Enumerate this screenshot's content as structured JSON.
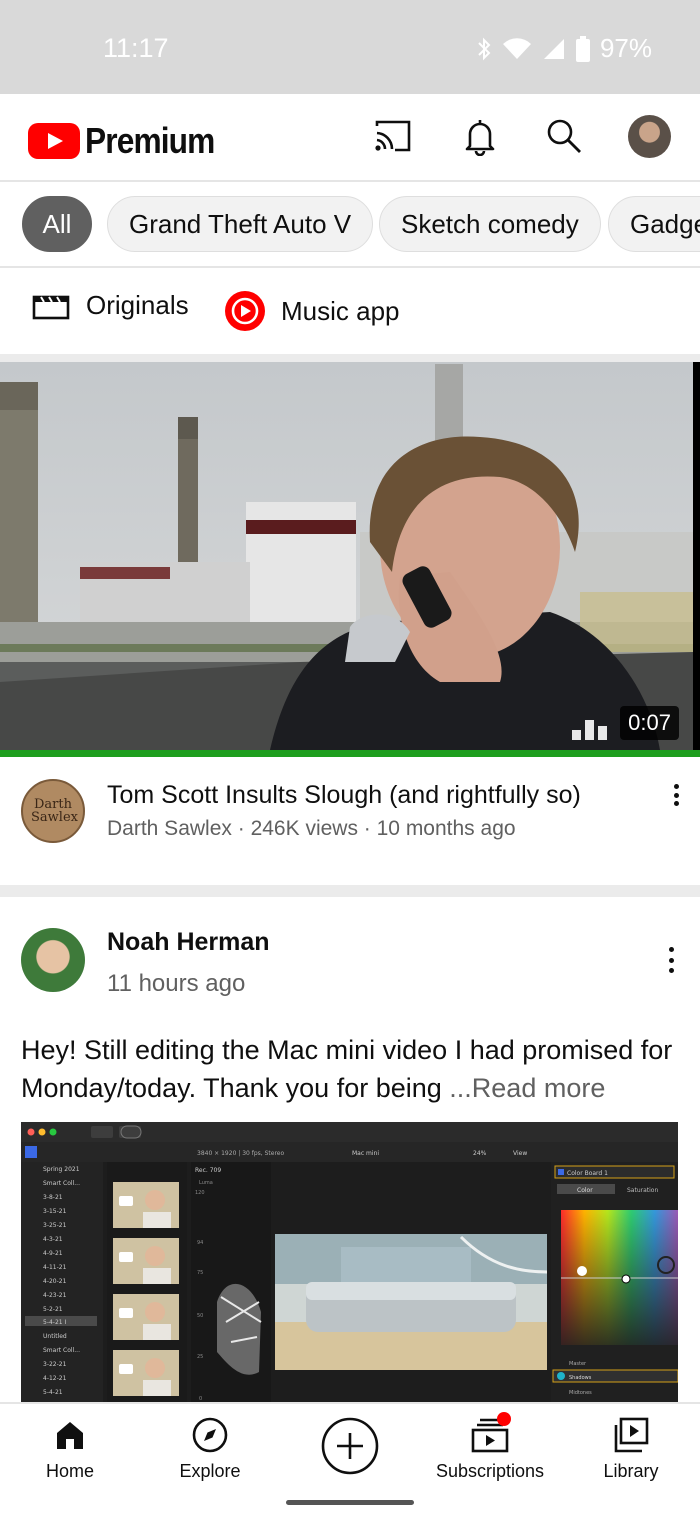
{
  "status_bar": {
    "time": "11:17",
    "battery": "97%"
  },
  "header": {
    "logo_text": "Premium",
    "icons": [
      "cast-icon",
      "bell-icon",
      "search-icon",
      "account-avatar"
    ]
  },
  "chips": [
    "All",
    "Grand Theft Auto V",
    "Sketch comedy",
    "Gadgets"
  ],
  "shortcuts": {
    "originals": "Originals",
    "music": "Music app"
  },
  "video": {
    "duration": "0:07",
    "title": "Tom Scott Insults Slough (and rightfully so)",
    "channel": "Darth Sawlex",
    "views": "246K views",
    "age": "10 months ago",
    "channel_avatar_text": "Darth Sawlex"
  },
  "post": {
    "author": "Noah Herman",
    "time": "11 hours ago",
    "text": "Hey! Still editing the Mac mini video I had promised for Monday/today. Thank you for being ",
    "read_more": "...Read more"
  },
  "editor": {
    "library_header": "Spring 2021",
    "library_items": [
      "Smart Coll...",
      "3-8-21",
      "3-15-21",
      "3-25-21",
      "4-3-21",
      "4-9-21",
      "4-11-21",
      "4-20-21",
      "4-23-21",
      "5-2-21",
      "5-4-21 I",
      "Untitled",
      "Smart Coll...",
      "3-22-21",
      "4-12-21",
      "5-4-21"
    ],
    "format": "3840 × 1920 | 30 fps, Stereo",
    "project": "Mac mini",
    "zoom": "24%",
    "view": "View",
    "scope": "Rec. 709",
    "luma": "Luma",
    "scale": [
      "120",
      "94",
      "75",
      "50",
      "25",
      "0"
    ],
    "color_board": "Color Board 1",
    "tabs": [
      "Color",
      "Saturation"
    ],
    "ranges": [
      "Master",
      "Shadows",
      "Midtones"
    ]
  },
  "nav": [
    {
      "label": "Home",
      "icon": "home-icon"
    },
    {
      "label": "Explore",
      "icon": "compass-icon"
    },
    {
      "label": "",
      "icon": "create-icon"
    },
    {
      "label": "Subscriptions",
      "icon": "subscriptions-icon"
    },
    {
      "label": "Library",
      "icon": "library-icon"
    }
  ],
  "colors": {
    "brand_red": "#ff0000",
    "progress_green": "#1e9e1e",
    "chip_active": "#606060"
  }
}
